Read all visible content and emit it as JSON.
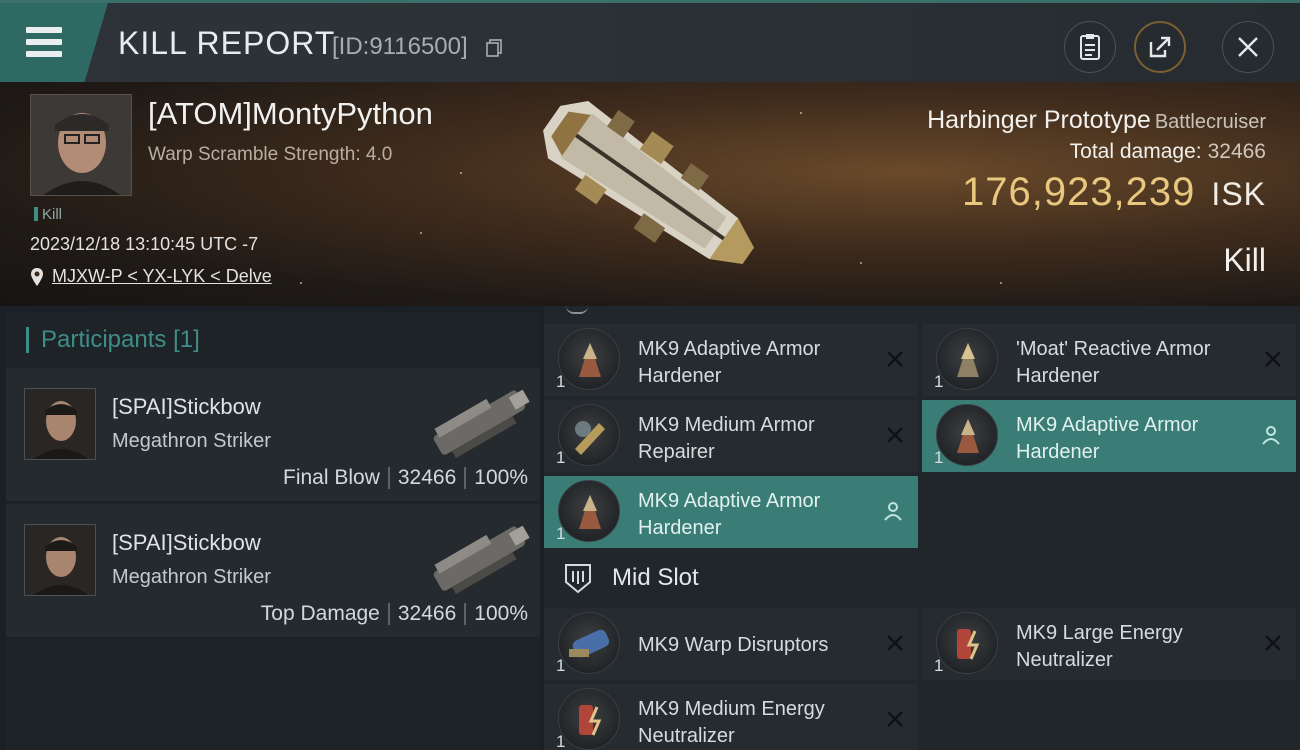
{
  "header": {
    "title": "KILL REPORT",
    "id_text": "[ID:9116500]"
  },
  "victim": {
    "name": "[ATOM]MontyPython",
    "warp_scramble": "Warp Scramble Strength: 4.0",
    "badge": "Kill",
    "datetime": "2023/12/18 13:10:45 UTC -7",
    "location": "MJXW-P < YX-LYK < Delve",
    "ship_name": "Harbinger Prototype",
    "ship_class": "Battlecruiser",
    "total_damage_label": "Total damage:",
    "total_damage": "32466",
    "isk_value": "176,923,239",
    "isk_unit": "ISK",
    "result": "Kill"
  },
  "participants": {
    "header": "Participants",
    "count": "[1]",
    "items": [
      {
        "name": "[SPAI]Stickbow",
        "ship": "Megathron Striker",
        "role": "Final Blow",
        "damage": "32466",
        "percent": "100%"
      },
      {
        "name": "[SPAI]Stickbow",
        "ship": "Megathron Striker",
        "role": "Top Damage",
        "damage": "32466",
        "percent": "100%"
      }
    ]
  },
  "modules": {
    "low_slot": [
      {
        "qty": "1",
        "name": "MK9 Adaptive Armor Hardener",
        "state": "destroyed"
      },
      {
        "qty": "1",
        "name": "'Moat' Reactive Armor Hardener",
        "state": "destroyed"
      },
      {
        "qty": "1",
        "name": "MK9 Medium Armor Repairer",
        "state": "destroyed"
      },
      {
        "qty": "1",
        "name": "MK9 Adaptive Armor Hardener",
        "state": "dropped"
      },
      {
        "qty": "1",
        "name": "MK9 Adaptive Armor Hardener",
        "state": "dropped"
      }
    ],
    "mid_slot_title": "Mid Slot",
    "mid_slot": [
      {
        "qty": "1",
        "name": "MK9 Warp Disruptors",
        "state": "destroyed"
      },
      {
        "qty": "1",
        "name": "MK9 Large Energy Neutralizer",
        "state": "destroyed"
      },
      {
        "qty": "1",
        "name": "MK9 Medium Energy Neutralizer",
        "state": "destroyed"
      }
    ]
  },
  "colors": {
    "accent_teal": "#3a7c76",
    "isk_gold": "#e8c77e",
    "panel": "#262b30"
  },
  "icons": [
    "menu-icon",
    "copy-icon",
    "clipboard-icon",
    "share-icon",
    "close-icon",
    "location-pin-icon",
    "destroyed-x-icon",
    "dropped-user-icon",
    "mid-slot-icon"
  ]
}
